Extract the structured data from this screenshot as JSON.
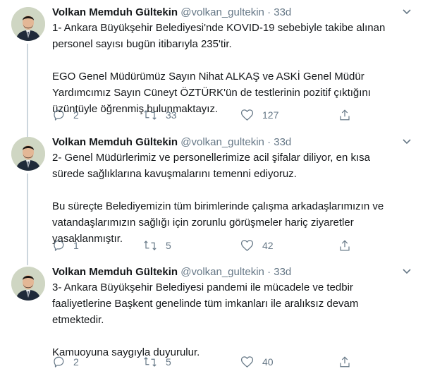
{
  "tweets": [
    {
      "author_name": "Volkan Memduh Gültekin",
      "handle": "@volkan_gultekin",
      "separator": "·",
      "age": "33d",
      "paragraphs": [
        "1- Ankara Büyükşehir Belediyesi'nde KOVID-19 sebebiyle takibe alınan\npersonel sayısı bugün itibarıyla 235'tir.",
        "EGO Genel Müdürümüz Sayın Nihat ALKAŞ ve ASKİ Genel Müdür\nYardımcımız Sayın Cüneyt ÖZTÜRK'ün de testlerinin pozitif çıktığını\nüzüntüyle öğrenmiş bulunmaktayız."
      ],
      "replies": "2",
      "retweets": "33",
      "likes": "127"
    },
    {
      "author_name": "Volkan Memduh Gültekin",
      "handle": "@volkan_gultekin",
      "separator": "·",
      "age": "33d",
      "paragraphs": [
        "2- Genel Müdürlerimiz ve personellerimize acil şifalar diliyor, en kısa\nsürede sağlıklarına kavuşmalarını temenni ediyoruz.",
        "Bu süreçte Belediyemizin tüm birimlerinde çalışma arkadaşlarımızın ve\nvatandaşlarımızın sağlığı için zorunlu görüşmeler hariç ziyaretler\nyasaklanmıştır."
      ],
      "replies": "1",
      "retweets": "5",
      "likes": "42"
    },
    {
      "author_name": "Volkan Memduh Gültekin",
      "handle": "@volkan_gultekin",
      "separator": "·",
      "age": "33d",
      "paragraphs": [
        "3- Ankara Büyükşehir Belediyesi pandemi ile mücadele ve tedbir\nfaaliyetlerine Başkent genelinde tüm imkanları ile aralıksız devam\netmektedir.",
        "Kamuoyuna saygıyla duyurulur."
      ],
      "replies": "2",
      "retweets": "5",
      "likes": "40"
    }
  ],
  "icons": {
    "reply": "reply-icon",
    "retweet": "retweet-icon",
    "like": "heart-icon",
    "share": "share-icon",
    "menu": "chevron-down-icon"
  },
  "colors": {
    "text": "#14171a",
    "secondary": "#657786",
    "thread_line": "#ccd6dd",
    "background": "#ffffff"
  }
}
